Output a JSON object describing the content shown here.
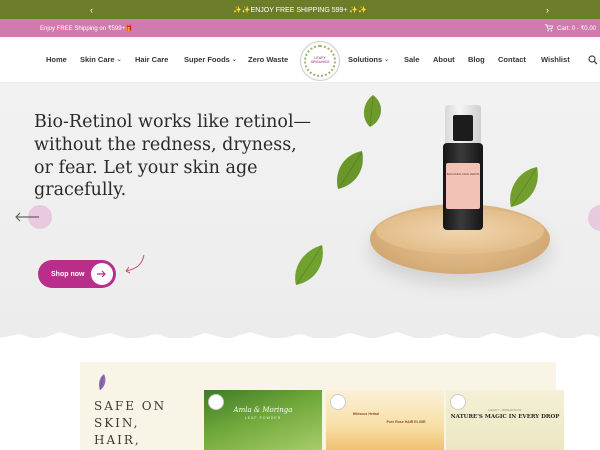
{
  "announcement": {
    "text": "✨✨ENJOY FREE SHIPPING 599+ ✨✨"
  },
  "shipping_bar": {
    "message": "Enjoy FREE Shipping on ₹599+🎁",
    "cart_label": "Cart: 0 - ₹0.00"
  },
  "nav": {
    "items": [
      {
        "label": "Home"
      },
      {
        "label": "Skin Care"
      },
      {
        "label": "Hair Care"
      },
      {
        "label": "Super Foods"
      },
      {
        "label": "Zero Waste"
      },
      {
        "label": "Solutions"
      },
      {
        "label": "Sale"
      },
      {
        "label": "About"
      },
      {
        "label": "Blog"
      },
      {
        "label": "Contact"
      },
      {
        "label": "Wishlist"
      }
    ],
    "logo_text": "LEAFY ORGANICS"
  },
  "hero": {
    "headline": "Bio-Retinol works like retinol—without the redness, dryness, or fear. Let your skin age gracefully.",
    "cta_label": "Shop now",
    "product_label": "BAKUCHIOL FACE SERUM"
  },
  "lower": {
    "tagline": "SAFE ON SKIN, HAIR,",
    "cards": [
      {
        "title": "Amla & Moringa",
        "subtitle": "LEAF POWDER"
      },
      {
        "title": "Hibiscus Herbal",
        "subtitle": "Pure Rose HAIR ELIXIR"
      },
      {
        "title": "NATURE'S MAGIC IN EVERY DROP",
        "subtitle": "LEAFY ORGANICS"
      }
    ]
  },
  "colors": {
    "olive": "#6c7d2a",
    "pink": "#d17aae",
    "magenta_cta": "#b82e8a"
  }
}
